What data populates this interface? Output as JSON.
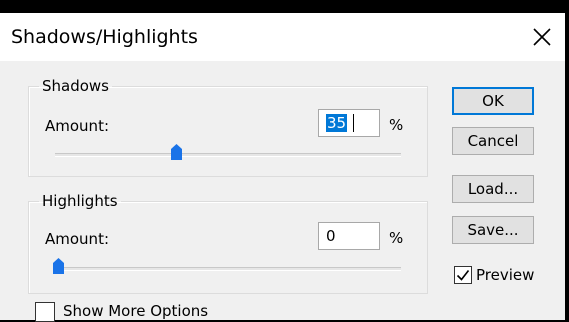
{
  "dialog": {
    "title": "Shadows/Highlights",
    "close_icon": "close-icon"
  },
  "shadows": {
    "legend": "Shadows",
    "amount_label": "Amount:",
    "amount_value": "35",
    "unit": "%",
    "slider_percent": 35
  },
  "highlights": {
    "legend": "Highlights",
    "amount_label": "Amount:",
    "amount_value": "0",
    "unit": "%",
    "slider_percent": 0
  },
  "buttons": {
    "ok": "OK",
    "cancel": "Cancel",
    "load": "Load...",
    "save": "Save..."
  },
  "preview": {
    "label": "Preview",
    "checked": true
  },
  "show_more_options": {
    "label": "Show More Options",
    "checked": false
  },
  "colors": {
    "accent": "#0078d7",
    "thumb": "#1a73e8"
  }
}
